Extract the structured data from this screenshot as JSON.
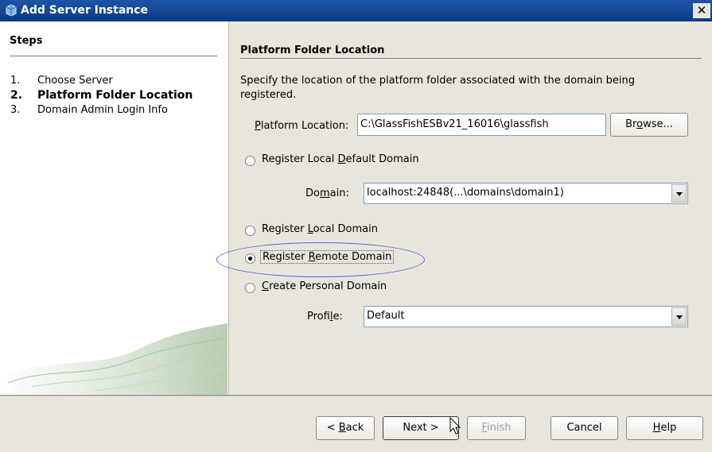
{
  "window": {
    "title": "Add Server Instance",
    "close_glyph": "✕"
  },
  "steps": {
    "heading": "Steps",
    "items": [
      {
        "num": "1.",
        "label": "Choose Server",
        "active": false
      },
      {
        "num": "2.",
        "label": "Platform Folder Location",
        "active": true
      },
      {
        "num": "3.",
        "label": "Domain Admin Login Info",
        "active": false
      }
    ]
  },
  "panel": {
    "heading": "Platform Folder Location",
    "description": "Specify the location of the platform folder associated with the domain being registered.",
    "platform_location": {
      "label_pre": "",
      "label_mnemonic": "P",
      "label_post": "latform Location:",
      "value": "C:\\GlassFishESBv21_16016\\glassfish",
      "browse_pre": "Br",
      "browse_mnemonic": "o",
      "browse_post": "wse..."
    },
    "radios": {
      "local_default": {
        "pre": "Register Local ",
        "mnemonic": "D",
        "post": "efault Domain",
        "checked": false
      },
      "local": {
        "pre": "Register ",
        "mnemonic": "L",
        "post": "ocal Domain",
        "checked": false
      },
      "remote": {
        "pre": "Register ",
        "mnemonic": "R",
        "post": "emote Domain",
        "checked": true
      },
      "personal": {
        "pre": "",
        "mnemonic": "C",
        "post": "reate Personal Domain",
        "checked": false
      }
    },
    "domain": {
      "label_pre": "Do",
      "label_mnemonic": "m",
      "label_post": "ain:",
      "value": "localhost:24848(...\\domains\\domain1)"
    },
    "profile": {
      "label_pre": "Profi",
      "label_mnemonic": "l",
      "label_post": "e:",
      "value": "Default"
    }
  },
  "footer": {
    "back": {
      "pre": "< ",
      "mnemonic": "B",
      "post": "ack"
    },
    "next": "Next >",
    "finish": {
      "pre": "",
      "mnemonic": "F",
      "post": "inish"
    },
    "cancel": "Cancel",
    "help": {
      "pre": "",
      "mnemonic": "H",
      "post": "elp"
    }
  },
  "icons": [
    "server-instance-icon",
    "close-icon",
    "cursor-arrow-icon"
  ],
  "colors": {
    "title_bar": "#0a3a85",
    "panel_bg": "#e8e5dc",
    "highlight": "#5a5fd6"
  }
}
